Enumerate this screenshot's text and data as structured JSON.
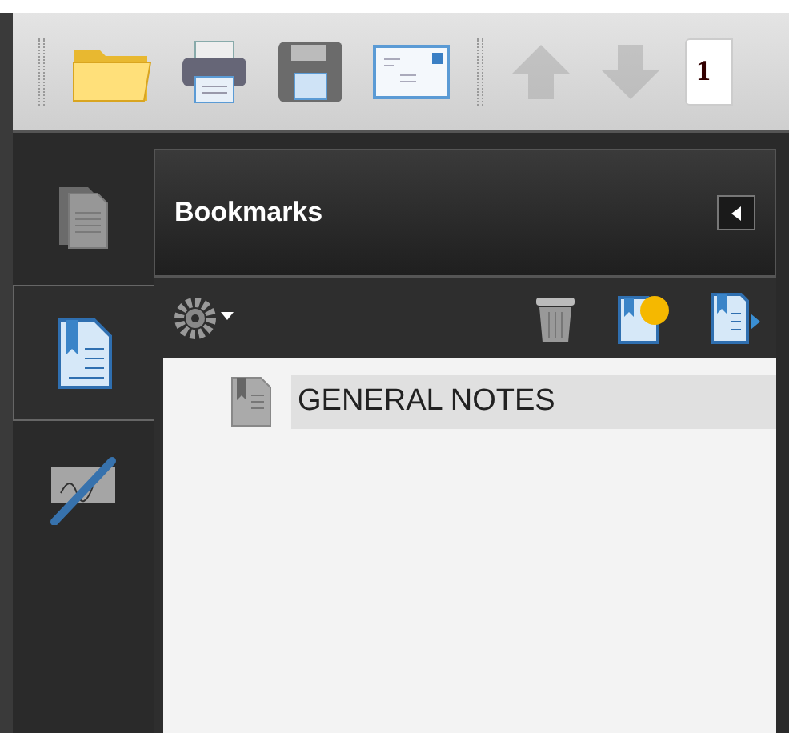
{
  "toolbar": {
    "buttons": [
      {
        "kind": "open",
        "disabled": false
      },
      {
        "kind": "print",
        "disabled": false
      },
      {
        "kind": "save",
        "disabled": false
      },
      {
        "kind": "email",
        "disabled": false
      },
      {
        "kind": "separator"
      },
      {
        "kind": "up",
        "disabled": true
      },
      {
        "kind": "down",
        "disabled": true
      }
    ],
    "page_field": {
      "value": "1"
    }
  },
  "side_tabs": [
    {
      "kind": "pages",
      "selected": false
    },
    {
      "kind": "bookmarks",
      "selected": true
    },
    {
      "kind": "signatures",
      "selected": false
    }
  ],
  "panel": {
    "title": "Bookmarks",
    "tools": [
      {
        "kind": "options"
      },
      {
        "kind": "delete"
      },
      {
        "kind": "new"
      },
      {
        "kind": "export"
      }
    ],
    "bookmarks": [
      {
        "label": "GENERAL NOTES",
        "selected": true
      }
    ]
  }
}
